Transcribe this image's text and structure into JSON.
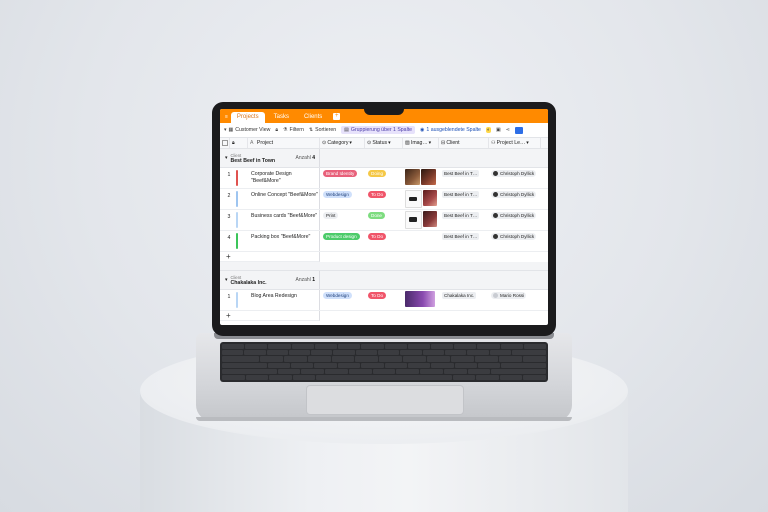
{
  "app": {
    "tabs": [
      {
        "label": "Projects",
        "active": true
      },
      {
        "label": "Tasks",
        "active": false
      },
      {
        "label": "Clients",
        "active": false
      }
    ],
    "tab_add": "+",
    "colors": {
      "accent": "#ff8a00"
    }
  },
  "toolbar": {
    "view": "Customer View",
    "filter": "Filtern",
    "sort": "Sortieren",
    "group": "Gruppierung über 1 Spalte",
    "hidden": "1 ausgeblendete Spalte"
  },
  "columns": [
    "Project",
    "Category",
    "Status",
    "Imag…",
    "Client",
    "Project Le…"
  ],
  "groups": [
    {
      "field_label": "Client",
      "value": "Best Beef in Town",
      "count_label": "Anzahl",
      "count": "4",
      "rows": [
        {
          "num": "1",
          "name": "Corporate Design \"Beef&More\"",
          "bar": "#e0524f",
          "category": "Brand Identity",
          "cat_color": "#e8607a",
          "status": "Doing",
          "status_color": "#f5c846",
          "client": "Best Beef in T…",
          "lead": "Christoph Dyllick"
        },
        {
          "num": "2",
          "name": "Online Concept \"Beef&More\"",
          "bar": "#9ec5f0",
          "category": "Webdesign",
          "cat_color": "#cfe0fb",
          "status": "To Do",
          "status_color": "#f0556a",
          "client": "Best Beef in T…",
          "lead": "Christoph Dyllick"
        },
        {
          "num": "3",
          "name": "Business cards \"Beef&More\"",
          "bar": "#b9d6f5",
          "category": "Print",
          "cat_color": "#eceef1",
          "status": "Done",
          "status_color": "#7ddc7f",
          "client": "Best Beef in T…",
          "lead": "Christoph Dyllick"
        },
        {
          "num": "4",
          "name": "Packing box \"Beef&More\"",
          "bar": "#3cc55a",
          "category": "Product design",
          "cat_color": "#4ccb6a",
          "status": "To Do",
          "status_color": "#f0556a",
          "client": "Best Beef in T…",
          "lead": "Christoph Dyllick"
        }
      ]
    },
    {
      "field_label": "Client",
      "value": "Chakalaka Inc.",
      "count_label": "Anzahl",
      "count": "1",
      "rows": [
        {
          "num": "1",
          "name": "Blog Area Redesign",
          "bar": "#b9d6f5",
          "category": "Webdesign",
          "cat_color": "#cfe0fb",
          "status": "To Do",
          "status_color": "#f0556a",
          "client": "Chakalaka Inc.",
          "lead": "Mario Rossi"
        }
      ]
    }
  ],
  "add_row": "+"
}
